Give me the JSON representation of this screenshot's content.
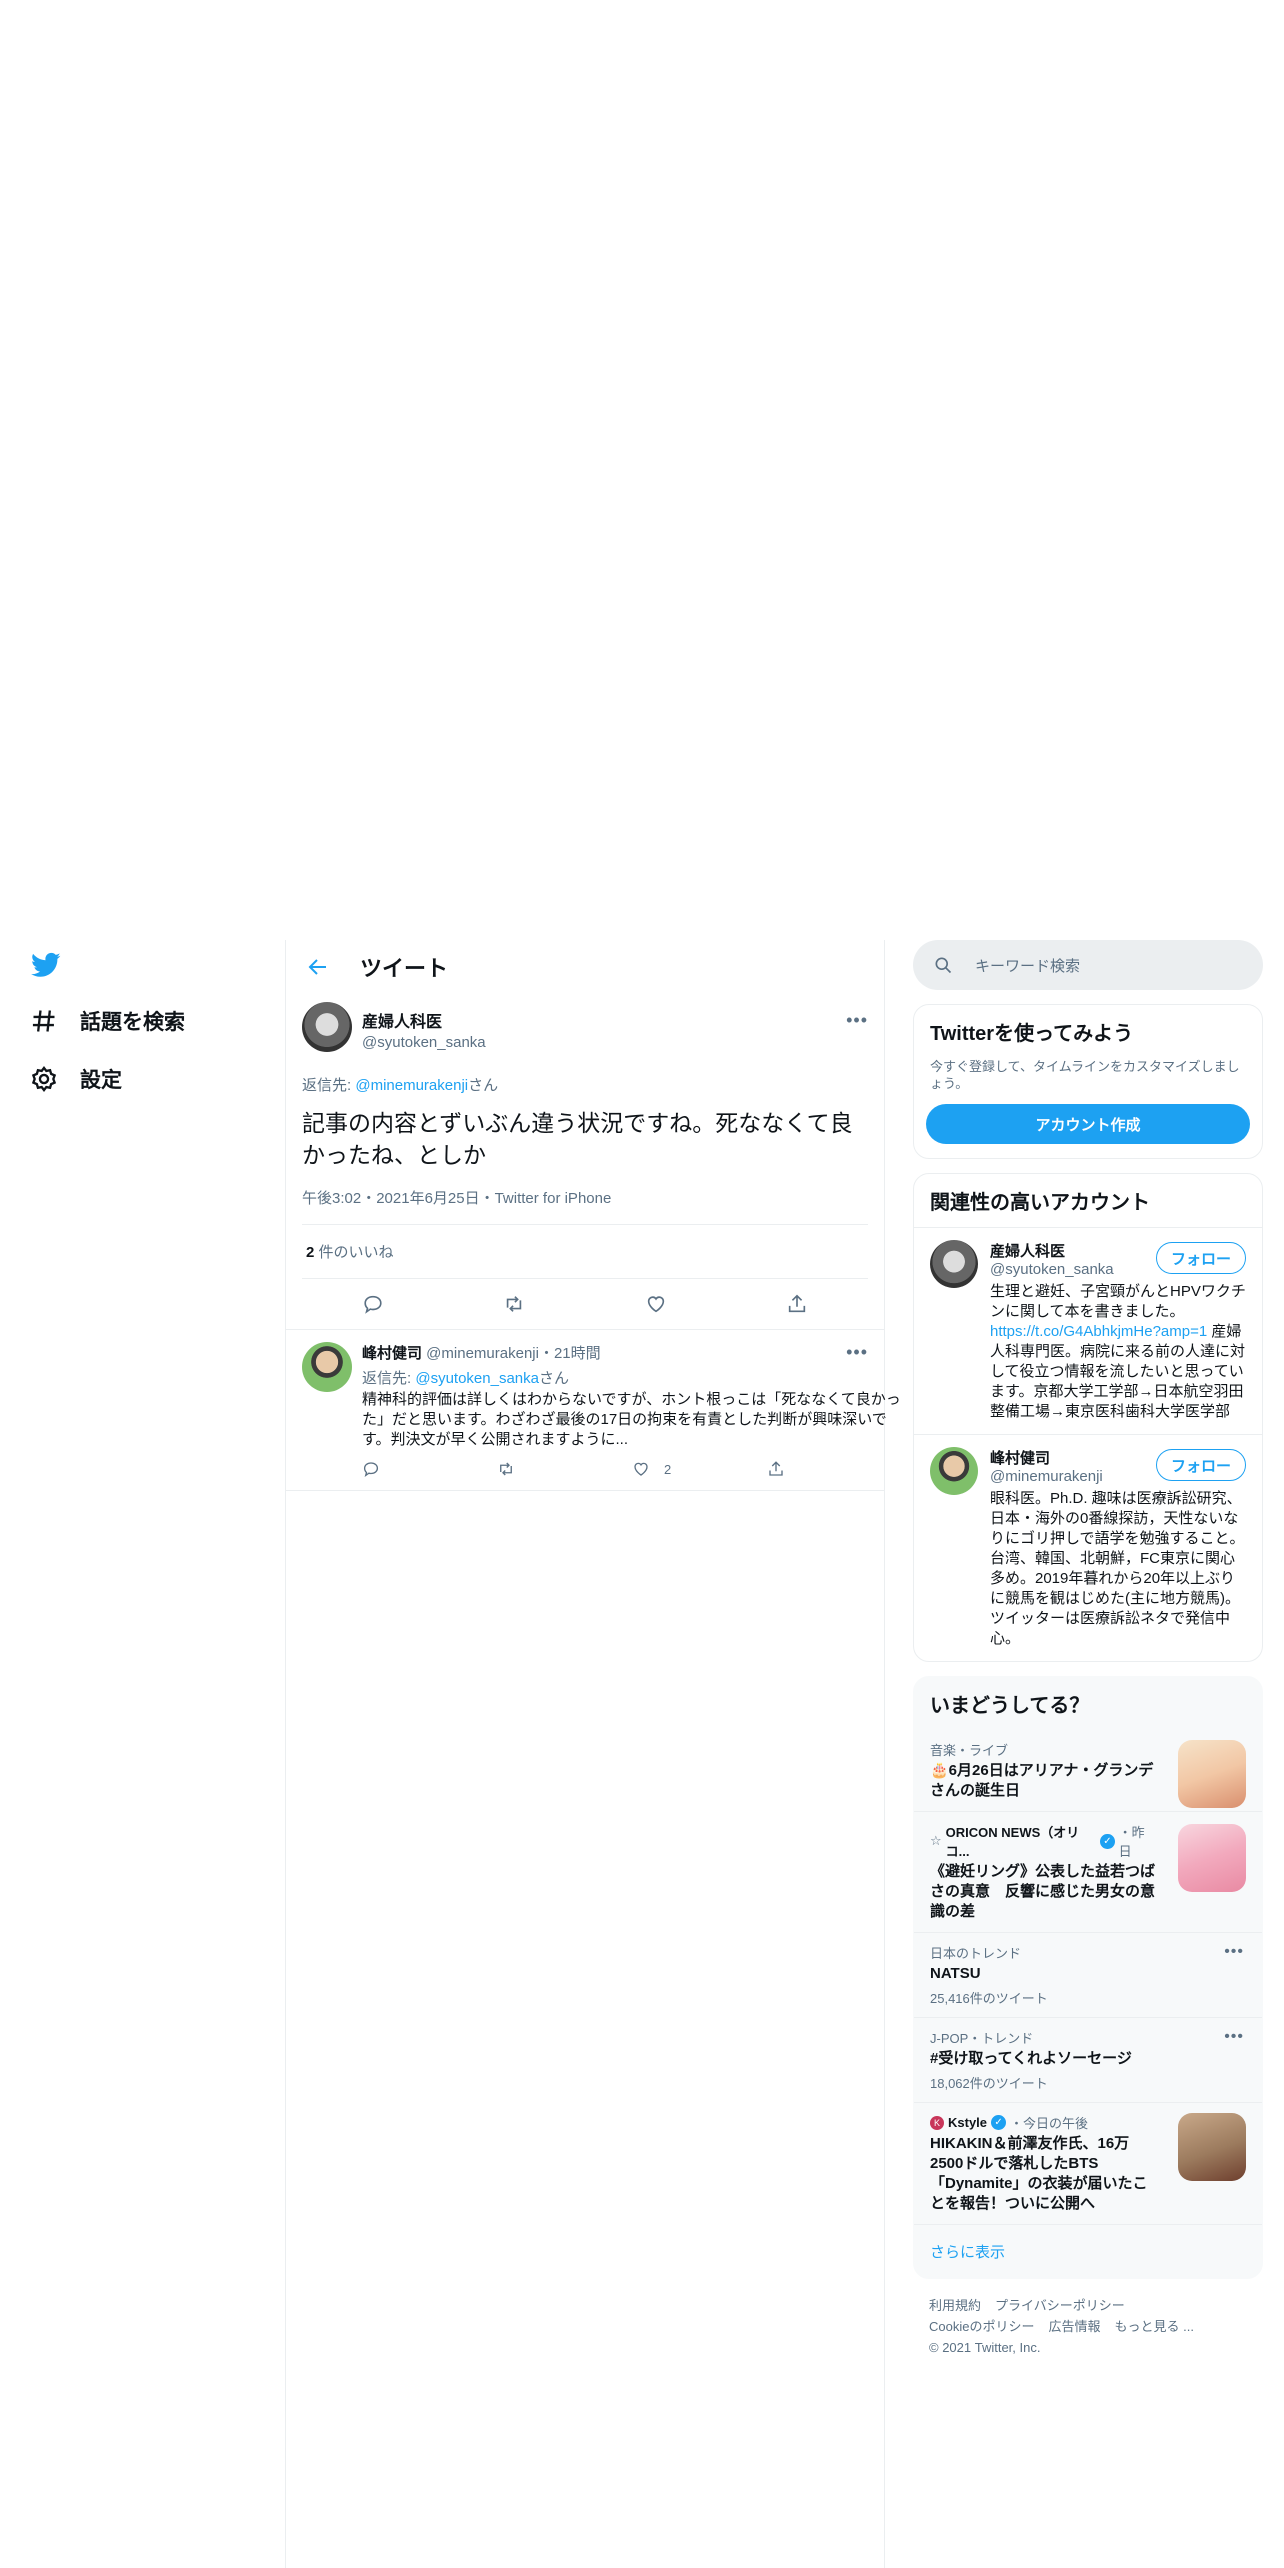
{
  "nav": {
    "explore_label": "話題を検索",
    "settings_label": "設定"
  },
  "header": {
    "title": "ツイート"
  },
  "main_tweet": {
    "author_name": "産婦人科医",
    "author_handle": "@syutoken_sanka",
    "reply_prefix": "返信先: ",
    "reply_to": "@minemurakenji",
    "reply_suffix": "さん",
    "text": "記事の内容とずいぶん違う状況ですね。死ななくて良かったね、としか",
    "timestamp": "午後3:02・2021年6月25日・Twitter for iPhone",
    "likes_count": "2",
    "likes_label": " 件のいいね"
  },
  "reply_tweet": {
    "author_name": "峰村健司",
    "author_meta": " @minemurakenji・21時間",
    "reply_prefix": "返信先: ",
    "reply_to": "@syutoken_sanka",
    "reply_suffix": "さん",
    "text": "精神科的評価は詳しくはわからないですが、ホント根っこは「死ななくて良かった」だと思います。わざわざ最後の17日の拘束を有責とした判断が興味深いです。判決文が早く公開されますように...",
    "like_count": "2"
  },
  "search": {
    "placeholder": "キーワード検索"
  },
  "signup": {
    "title": "Twitterを使ってみよう",
    "subtitle": "今すぐ登録して、タイムラインをカスタマイズしましょう。",
    "button": "アカウント作成"
  },
  "relevant": {
    "title": "関連性の高いアカウント",
    "follow_label": "フォロー",
    "accounts": [
      {
        "name": "産婦人科医",
        "handle": "@syutoken_sanka",
        "bio_before": "生理と避妊、子宮頸がんとHPVワクチンに関して本を書きました。",
        "bio_link": "https://t.co/G4AbhkjmHe?amp=1",
        "bio_after": " 産婦人科専門医。病院に来る前の人達に対して役立つ情報を流したいと思っています。京都大学工学部→日本航空羽田整備工場→東京医科歯科大学医学部"
      },
      {
        "name": "峰村健司",
        "handle": "@minemurakenji",
        "bio": "眼科医。Ph.D. 趣味は医療訴訟研究、日本・海外の0番線探訪，天性ないなりにゴリ押しで語学を勉強すること。台湾、韓国、北朝鮮，FC東京に関心多め。2019年暮れから20年以上ぶりに競馬を観はじめた(主に地方競馬)。ツイッターは医療訴訟ネタで発信中心。"
      }
    ]
  },
  "trends": {
    "title": "いまどうしてる？",
    "items": [
      {
        "context": "音楽・ライブ",
        "title": "🎂6月26日はアリアナ・グランデさんの誕生日"
      },
      {
        "context_name": "ORICON NEWS（オリコ...",
        "context_time": "・昨日",
        "title": "《避妊リング》公表した益若つばさの真意　反響に感じた男女の意識の差"
      },
      {
        "context": "日本のトレンド",
        "title": "NATSU",
        "count": "25,416件のツイート"
      },
      {
        "context": "J-POP・トレンド",
        "title": "#受け取ってくれよソーセージ",
        "count": "18,062件のツイート"
      },
      {
        "context_name": "Kstyle",
        "context_time": "・今日の午後",
        "title": "HIKAKIN＆前澤友作氏、16万2500ドルで落札したBTS「Dynamite」の衣装が届いたことを報告！ついに公開へ"
      }
    ],
    "show_more": "さらに表示"
  },
  "footer": {
    "links": [
      "利用規約",
      "プライバシーポリシー",
      "Cookieのポリシー",
      "広告情報",
      "もっと見る ..."
    ],
    "copyright": "© 2021 Twitter, Inc."
  },
  "colors": {
    "accent": "#1da1f2",
    "muted": "#5b7083",
    "border": "#ebeef0"
  }
}
